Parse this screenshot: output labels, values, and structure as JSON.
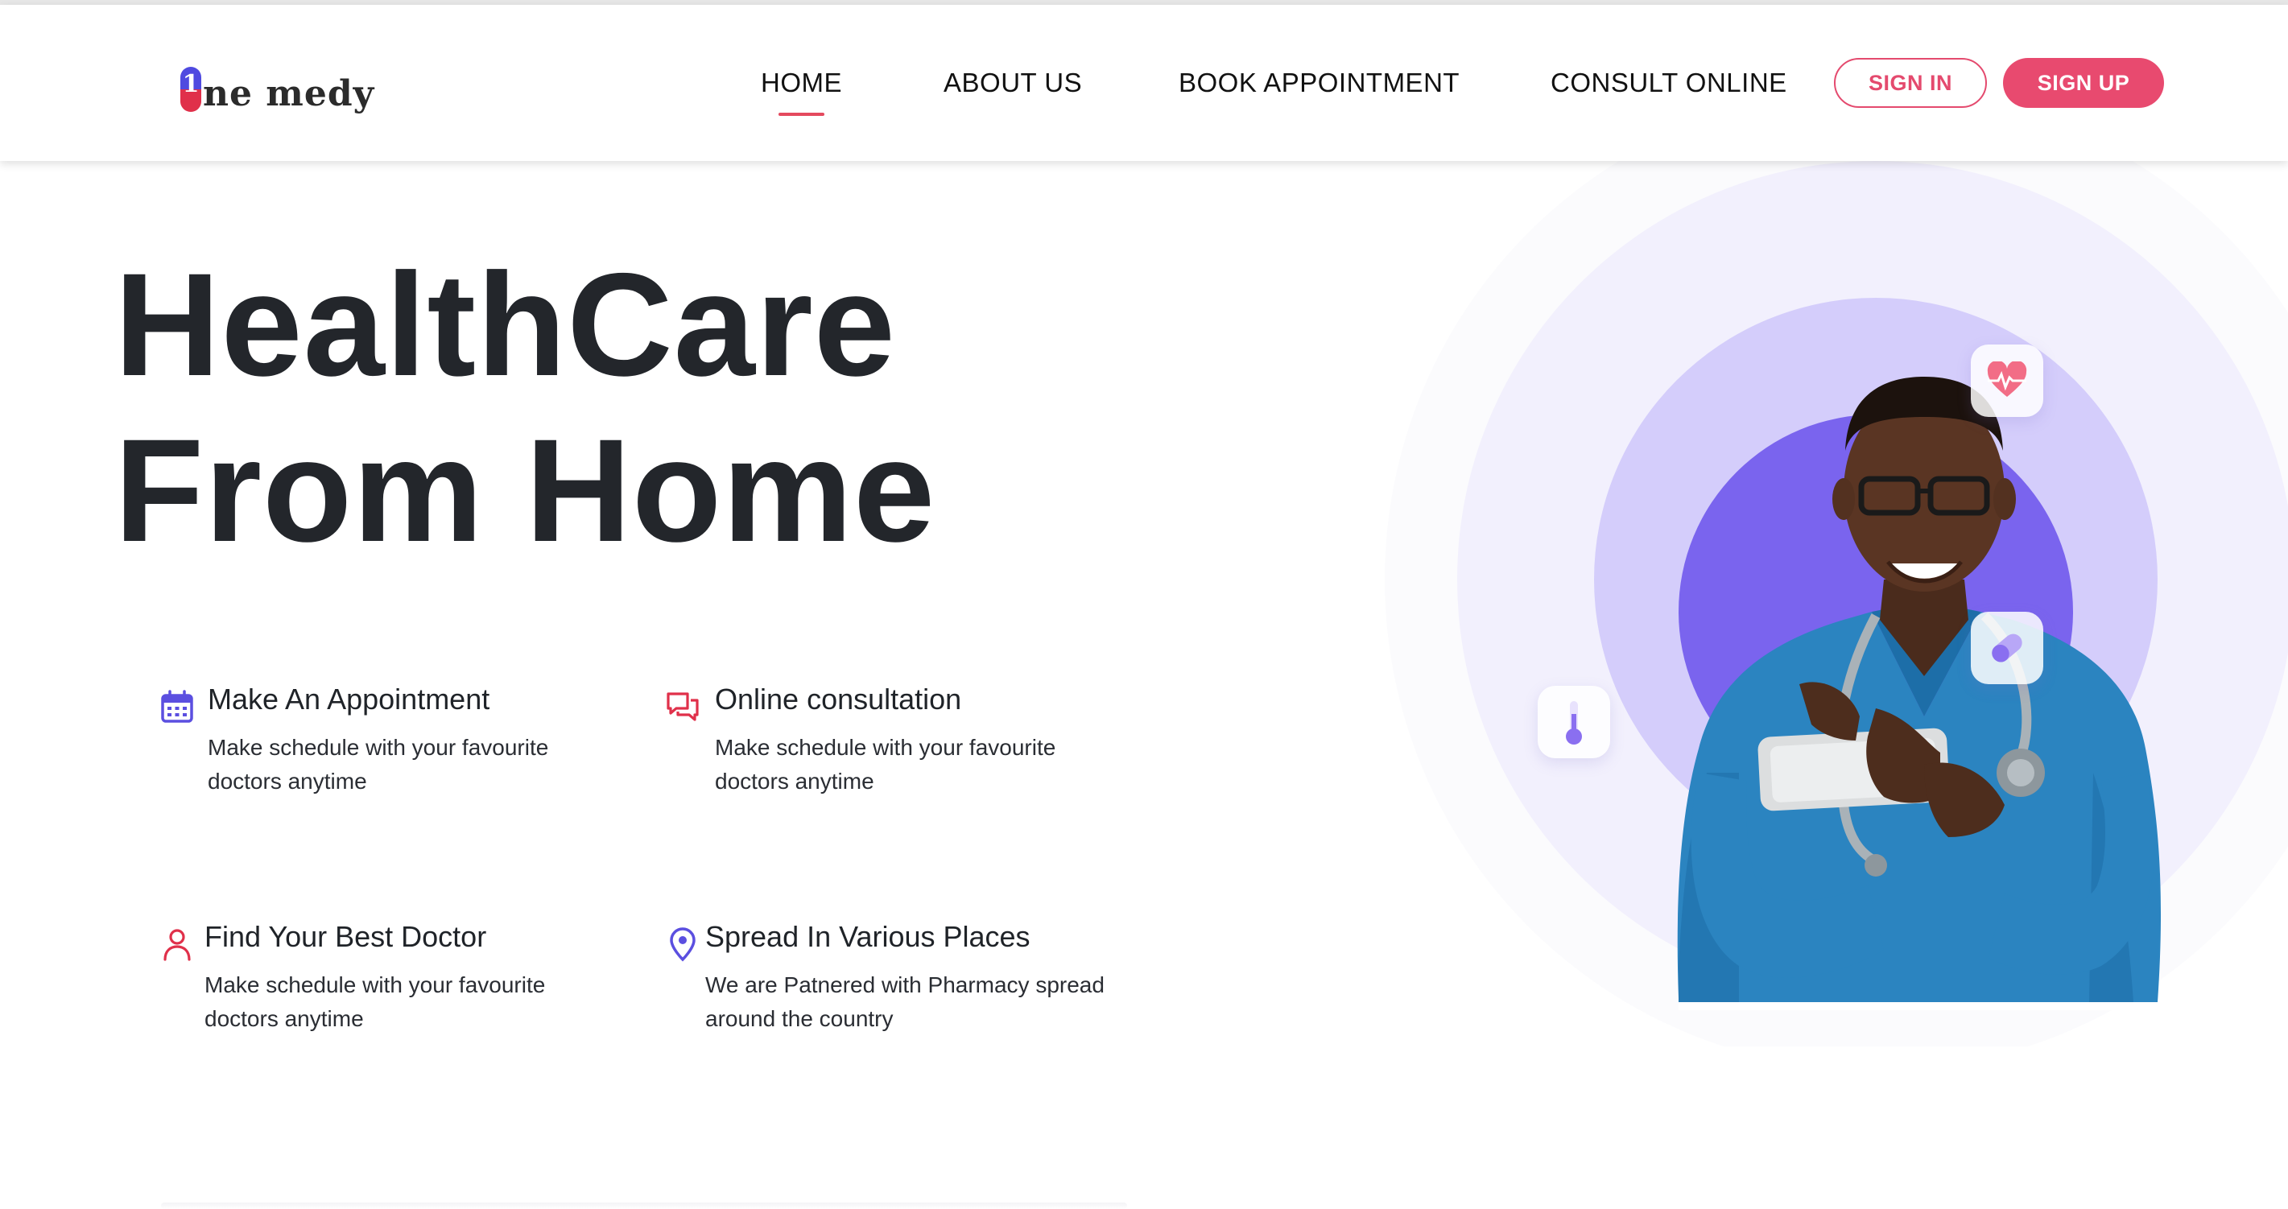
{
  "brand": {
    "logo_one": "1",
    "logo_text": "ne medy"
  },
  "nav": {
    "links": [
      "HOME",
      "ABOUT US",
      "BOOK APPOINTMENT",
      "CONSULT ONLINE"
    ],
    "active": "HOME",
    "sign_in": "SIGN IN",
    "sign_up": "SIGN UP"
  },
  "hero": {
    "title_line1": "HealthCare",
    "title_line2": "From Home"
  },
  "features": [
    {
      "icon": "calendar-icon",
      "title": "Make An Appointment",
      "desc": "Make schedule with your favourite doctors anytime"
    },
    {
      "icon": "chat-icon",
      "title": "Online consultation",
      "desc": "Make schedule with your favourite doctors anytime"
    },
    {
      "icon": "user-icon",
      "title": "Find Your Best Doctor",
      "desc": "Make schedule with your favourite doctors anytime"
    },
    {
      "icon": "location-pin-icon",
      "title": "Spread In Various Places",
      "desc": "We are Patnered with Pharmacy spread around the country"
    }
  ],
  "colors": {
    "accent_pink": "#e84a6f",
    "accent_purple": "#6b5ce7",
    "title_dark": "#23262b"
  },
  "illustration": {
    "subject": "doctor-photo",
    "floating_icons": [
      "heart-rate-icon",
      "pill-icon",
      "thermometer-icon"
    ]
  }
}
